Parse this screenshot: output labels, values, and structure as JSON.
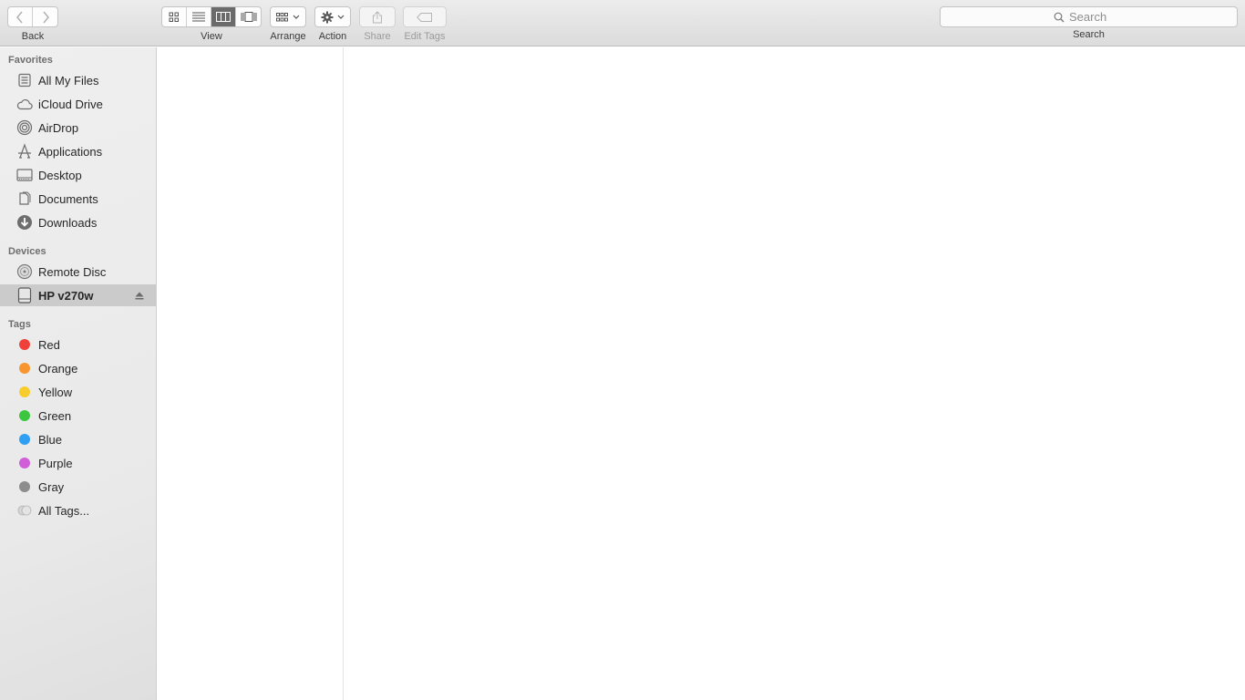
{
  "toolbar": {
    "back_label": "Back",
    "view_label": "View",
    "arrange_label": "Arrange",
    "action_label": "Action",
    "share_label": "Share",
    "edit_tags_label": "Edit Tags",
    "search_placeholder": "Search",
    "search_label": "Search",
    "active_view": "columns"
  },
  "sidebar": {
    "favorites_title": "Favorites",
    "favorites": [
      {
        "label": "All My Files",
        "icon": "all-files-icon"
      },
      {
        "label": "iCloud Drive",
        "icon": "cloud-icon"
      },
      {
        "label": "AirDrop",
        "icon": "airdrop-icon"
      },
      {
        "label": "Applications",
        "icon": "applications-icon"
      },
      {
        "label": "Desktop",
        "icon": "desktop-icon"
      },
      {
        "label": "Documents",
        "icon": "documents-icon"
      },
      {
        "label": "Downloads",
        "icon": "downloads-icon"
      }
    ],
    "devices_title": "Devices",
    "devices": [
      {
        "label": "Remote Disc",
        "icon": "disc-icon"
      },
      {
        "label": "HP v270w",
        "icon": "drive-icon",
        "selected": true
      }
    ],
    "tags_title": "Tags",
    "tags": [
      {
        "label": "Red",
        "color": "#f0403a"
      },
      {
        "label": "Orange",
        "color": "#f7962f"
      },
      {
        "label": "Yellow",
        "color": "#f6cd2d"
      },
      {
        "label": "Green",
        "color": "#3bc63d"
      },
      {
        "label": "Blue",
        "color": "#2e9ff2"
      },
      {
        "label": "Purple",
        "color": "#cf5ed8"
      },
      {
        "label": "Gray",
        "color": "#8d8d8d"
      },
      {
        "label": "All Tags...",
        "color": "#d0d0d0"
      }
    ]
  }
}
